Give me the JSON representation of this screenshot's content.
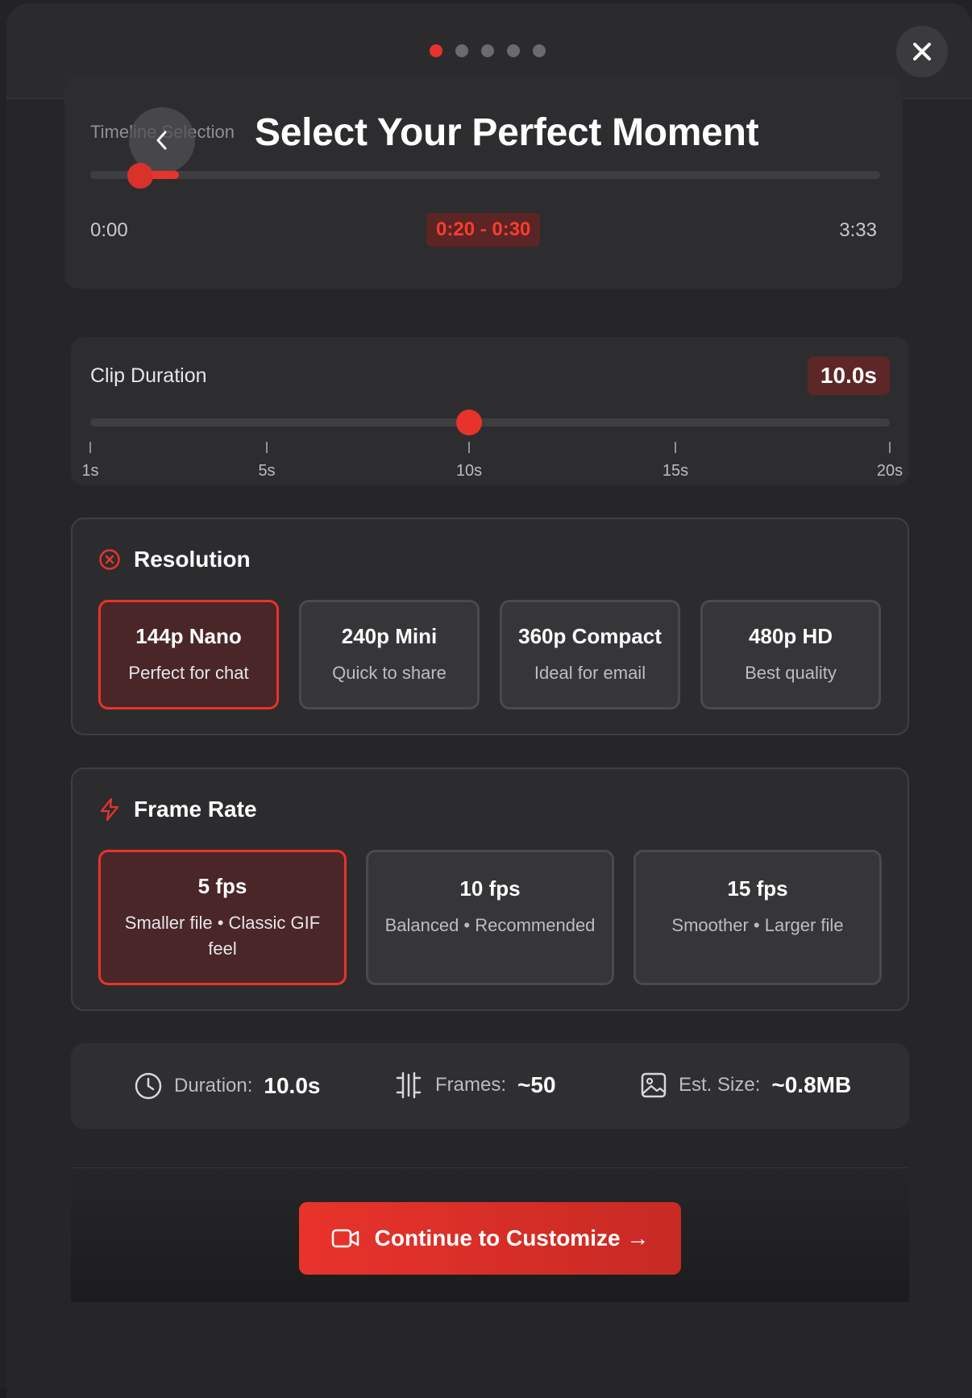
{
  "stepper": {
    "total": 5,
    "active": 1
  },
  "timeline": {
    "label": "Timeline Selection",
    "title": "Select Your Perfect Moment",
    "start_time": "0:00",
    "end_time": "3:33",
    "selected_range": "0:20 - 0:30"
  },
  "duration": {
    "label": "Clip Duration",
    "value": "10.0s",
    "slider_value_s": 10,
    "ticks": [
      "1s",
      "5s",
      "10s",
      "15s",
      "20s"
    ]
  },
  "resolution": {
    "title": "Resolution",
    "options": [
      {
        "title": "144p Nano",
        "subtitle": "Perfect for chat",
        "selected": true
      },
      {
        "title": "240p Mini",
        "subtitle": "Quick to share",
        "selected": false
      },
      {
        "title": "360p Compact",
        "subtitle": "Ideal for email",
        "selected": false
      },
      {
        "title": "480p HD",
        "subtitle": "Best quality",
        "selected": false
      }
    ]
  },
  "frame_rate": {
    "title": "Frame Rate",
    "options": [
      {
        "title": "5 fps",
        "subtitle": "Smaller file • Classic GIF feel",
        "selected": true
      },
      {
        "title": "10 fps",
        "subtitle": "Balanced • Recommended",
        "selected": false
      },
      {
        "title": "15 fps",
        "subtitle": "Smoother • Larger file",
        "selected": false
      }
    ]
  },
  "summary": {
    "duration_label": "Duration:",
    "duration_value": "10.0s",
    "frames_label": "Frames:",
    "frames_value": "~50",
    "size_label": "Est. Size:",
    "size_value": "~0.8MB"
  },
  "cta": {
    "label": "Continue to Customize →"
  },
  "colors": {
    "accent": "#e8332b",
    "background": "#262628",
    "card": "#2d2d30"
  },
  "icons": [
    "close-icon",
    "chevron-left-icon",
    "x-circle-icon",
    "lightning-icon",
    "clock-icon",
    "film-frames-icon",
    "image-icon",
    "video-camera-icon"
  ]
}
